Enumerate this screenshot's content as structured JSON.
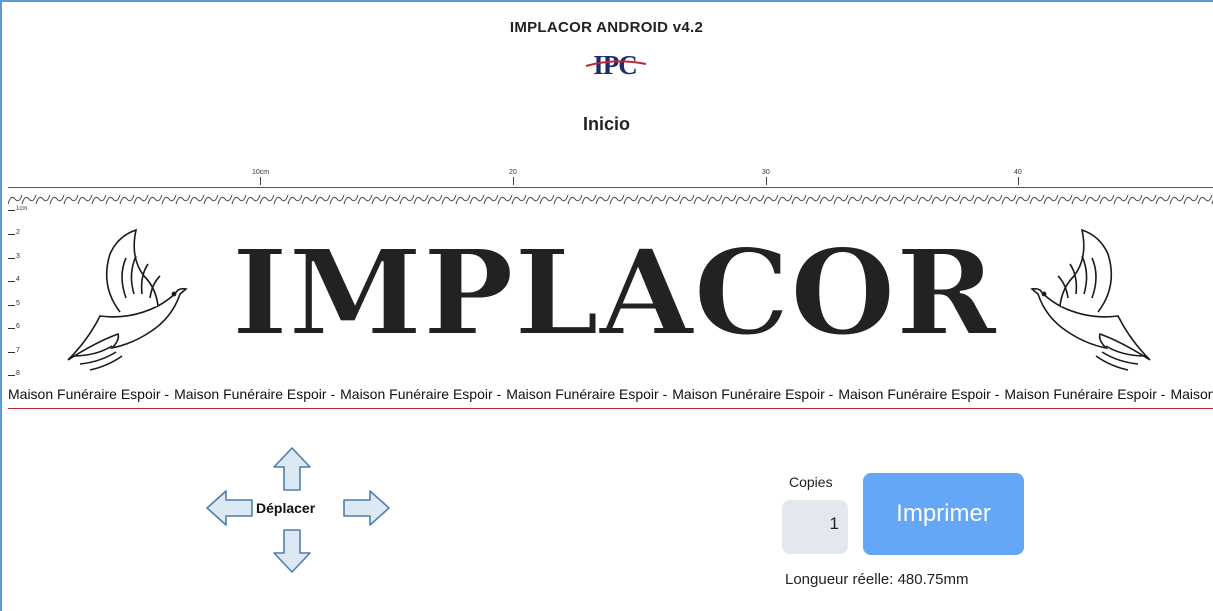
{
  "header": {
    "app_title": "IMPLACOR ANDROID v4.2",
    "logo_text": "IPC",
    "page_heading": "Inicio"
  },
  "ruler": {
    "top_labels": [
      "10cm",
      "20",
      "30",
      "40"
    ],
    "left_labels": [
      "1cm",
      "2",
      "3",
      "4",
      "5",
      "6",
      "7",
      "8"
    ]
  },
  "preview": {
    "main_text": "IMPLACOR",
    "bottom_text": "Maison Funéraire Espoir -",
    "bottom_repeated": [
      "Maison Funéraire Espoir -",
      "Maison Funéraire Espoir -",
      "Maison Funéraire Espoir -",
      "Maison Funéraire Espoir -",
      "Maison Funéraire Espoir -",
      "Maison Funéraire Espoir -",
      "Maison Funéraire Espoir -",
      "Maison Funéraire Espoir -"
    ],
    "ornament_glyph": "୨୧",
    "left_icon": "dove-icon",
    "right_icon": "dove-icon"
  },
  "controls": {
    "move_label": "Déplacer",
    "copies_label": "Copies",
    "copies_value": "1",
    "print_label": "Imprimer",
    "length_text": "Longueur réelle: 480.75mm"
  },
  "colors": {
    "frame": "#5b9bd5",
    "guide_line": "#c0282d",
    "print_button": "#64a7f6",
    "arrow_fill": "#dbe9f5",
    "arrow_stroke": "#4e7fae"
  }
}
